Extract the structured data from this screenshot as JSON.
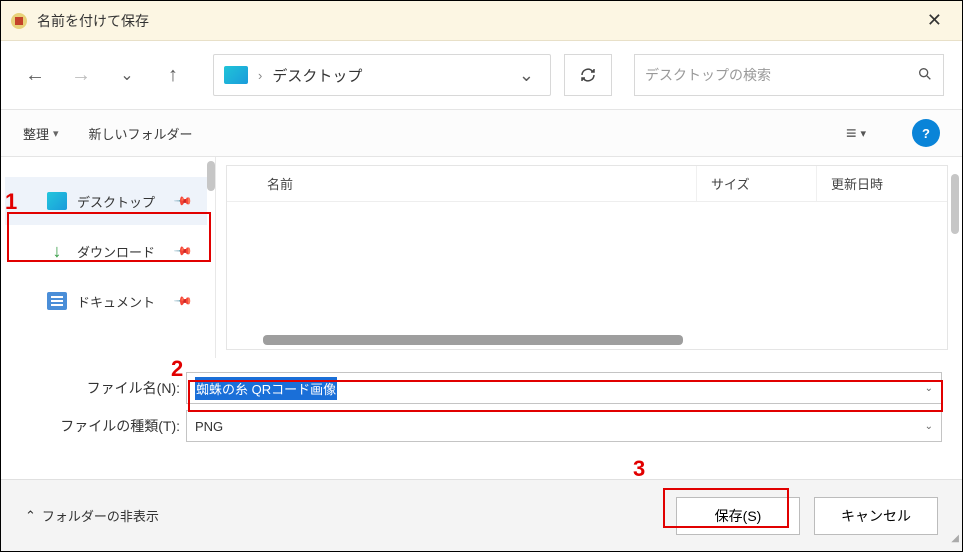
{
  "window": {
    "title": "名前を付けて保存"
  },
  "breadcrumb": {
    "location": "デスクトップ",
    "separator": "›"
  },
  "search": {
    "placeholder": "デスクトップの検索"
  },
  "toolbar": {
    "organize": "整理",
    "new_folder": "新しいフォルダー"
  },
  "sidebar": {
    "items": [
      {
        "label": "デスクトップ",
        "icon": "desktop",
        "selected": true
      },
      {
        "label": "ダウンロード",
        "icon": "download",
        "selected": false
      },
      {
        "label": "ドキュメント",
        "icon": "document",
        "selected": false
      }
    ]
  },
  "columns": {
    "name": "名前",
    "size": "サイズ",
    "date": "更新日時"
  },
  "fields": {
    "filename_label": "ファイル名(N):",
    "filename_value": "蜘蛛の糸 QRコード画像",
    "filetype_label": "ファイルの種類(T):",
    "filetype_value": "PNG"
  },
  "footer": {
    "hide_folders": "フォルダーの非表示",
    "save": "保存(S)",
    "cancel": "キャンセル"
  },
  "annotations": {
    "n1": "1",
    "n2": "2",
    "n3": "3"
  }
}
